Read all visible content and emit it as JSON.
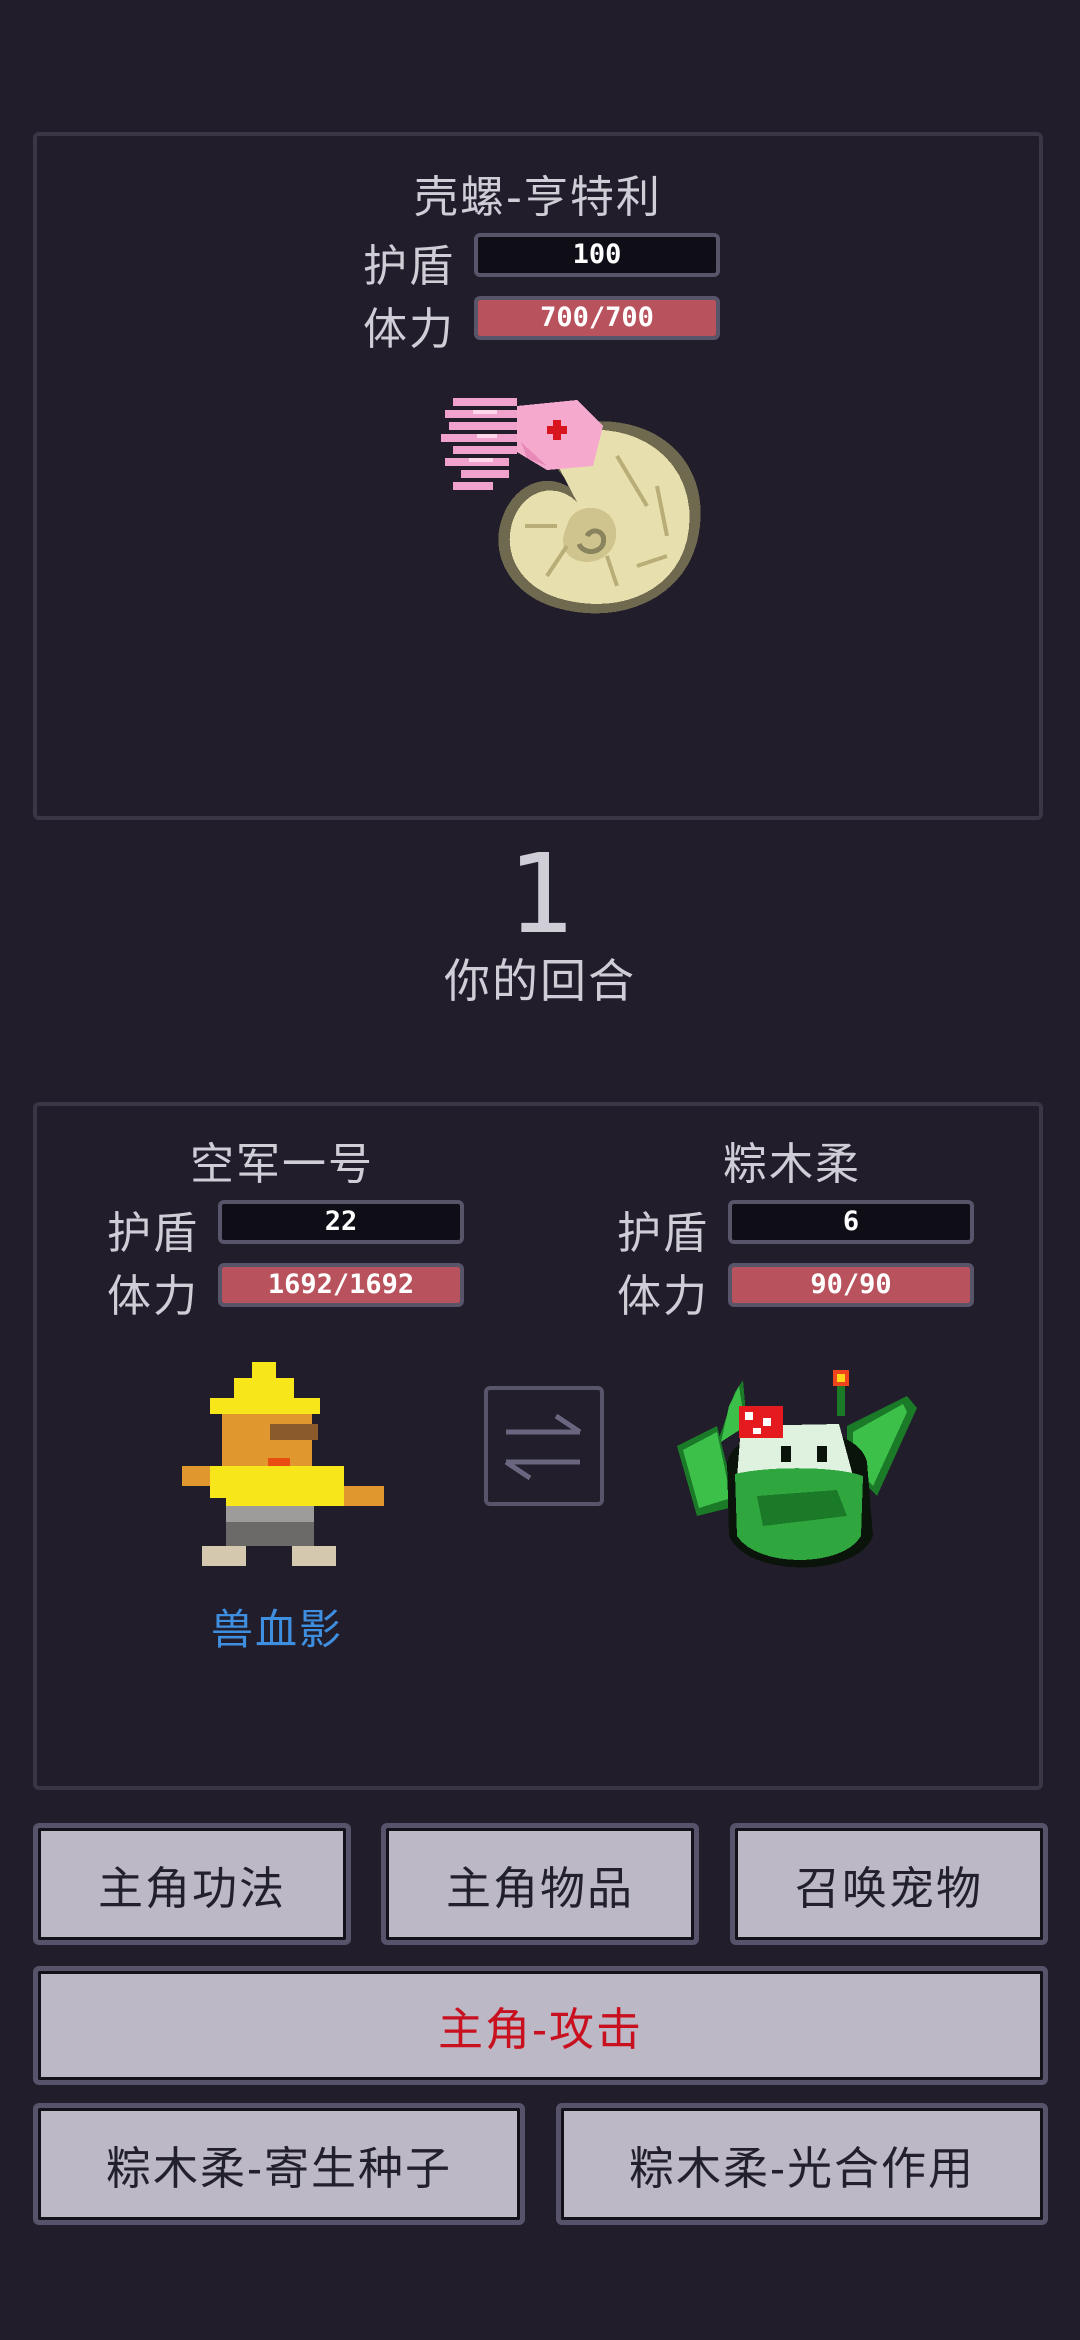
{
  "enemy": {
    "name": "壳螺-亨特利",
    "shield_label": "护盾",
    "shield_value": "100",
    "hp_label": "体力",
    "hp_text": "700/700",
    "hp_fraction": 1.0
  },
  "turn": {
    "number": "1",
    "label": "你的回合"
  },
  "hero": {
    "name": "空军一号",
    "shield_label": "护盾",
    "shield_value": "22",
    "hp_label": "体力",
    "hp_text": "1692/1692",
    "hp_fraction": 1.0
  },
  "pet": {
    "name": "粽木柔",
    "shield_label": "护盾",
    "shield_value": "6",
    "hp_label": "体力",
    "hp_text": "90/90",
    "hp_fraction": 1.0
  },
  "hero_pet_name": "兽血影",
  "actions": {
    "skills": "主角功法",
    "items": "主角物品",
    "summon": "召唤宠物",
    "attack": "主角-攻击",
    "pet_skill_1": "粽木柔-寄生种子",
    "pet_skill_2": "粽木柔-光合作用"
  },
  "colors": {
    "background": "#211d2a",
    "hp_bar": "#b8525c",
    "attack_text": "#c8101f",
    "pet_name": "#3f8fe0"
  }
}
